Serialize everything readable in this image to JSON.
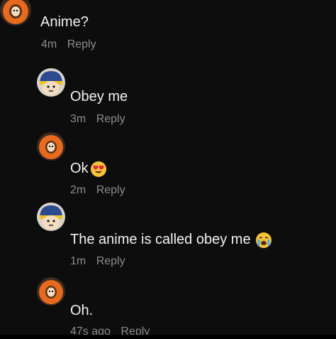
{
  "comments": [
    {
      "text": "Anime?",
      "time": "4m",
      "reply": "Reply",
      "avatar": "kenny-avatar",
      "emoji": ""
    },
    {
      "text": "Obey me",
      "time": "3m",
      "reply": "Reply",
      "avatar": "craig-avatar",
      "emoji": ""
    },
    {
      "text": "Ok",
      "time": "2m",
      "reply": "Reply",
      "avatar": "kenny-avatar",
      "emoji": "heart-eyes"
    },
    {
      "text": "The anime is called obey me",
      "time": "1m",
      "reply": "Reply",
      "avatar": "craig-avatar",
      "emoji": "crying"
    },
    {
      "text": "Oh.",
      "time": "47s ago",
      "reply": "Reply",
      "avatar": "kenny-avatar",
      "emoji": ""
    }
  ],
  "colors": {
    "background": "#0d0d0d",
    "text": "#f2f2f2",
    "meta": "#8c8c8c",
    "kenny_parka": "#e86a1f",
    "craig_hat": "#2c4a8f"
  }
}
